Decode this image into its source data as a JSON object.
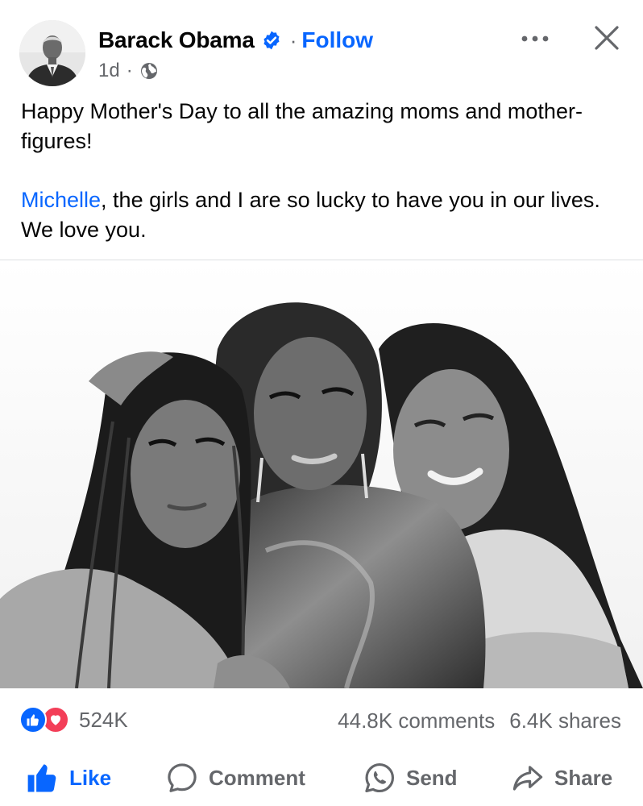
{
  "post": {
    "author": {
      "name": "Barack Obama",
      "verified": true,
      "follow_label": "Follow",
      "separator": "·"
    },
    "meta": {
      "timestamp": "1d",
      "separator": "·",
      "audience_icon": "globe-icon"
    },
    "text": {
      "line1": "Happy Mother's Day to all the amazing moms and mother-figures!",
      "mention": "Michelle",
      "line2_rest": ", the girls and I are so lucky to have you in our lives. We love you."
    },
    "photo": {
      "style": "black-and-white portrait of three women"
    },
    "stats": {
      "reaction_icons": [
        "like-reaction-icon",
        "love-reaction-icon"
      ],
      "reactions": "524K",
      "comments": "44.8K comments",
      "shares": "6.4K shares"
    },
    "actions": {
      "like": "Like",
      "comment": "Comment",
      "send": "Send",
      "share": "Share"
    }
  },
  "colors": {
    "brand_blue": "#0866ff",
    "text_primary": "#050505",
    "text_secondary": "#65676b",
    "love_red": "#f33e58",
    "divider": "#dddfe2"
  }
}
